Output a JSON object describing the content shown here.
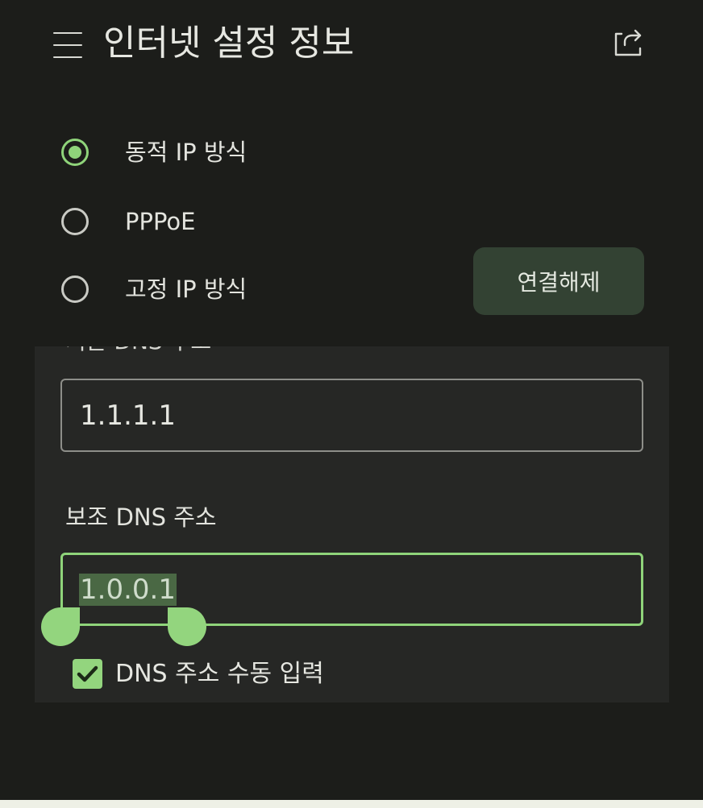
{
  "header": {
    "title": "인터넷 설정 정보",
    "menu_icon": "hamburger-menu-icon",
    "share_icon": "share-icon"
  },
  "connection_types": {
    "options": [
      {
        "label": "동적 IP 방식",
        "checked": true
      },
      {
        "label": "PPPoE",
        "checked": false
      },
      {
        "label": "고정 IP 방식",
        "checked": false
      }
    ]
  },
  "disconnect_button": {
    "label": "연결해제"
  },
  "dns": {
    "primary_label": "기본 DNS 주소",
    "primary_value": "1.1.1.1",
    "secondary_label": "보조 DNS 주소",
    "secondary_value": "1.0.0.1",
    "manual_label": "DNS 주소 수동 입력",
    "manual_checked": true
  },
  "colors": {
    "background": "#1c1d1a",
    "panel": "#262725",
    "accent": "#8fd47a",
    "button": "#334233",
    "selection": "#4a6844"
  }
}
